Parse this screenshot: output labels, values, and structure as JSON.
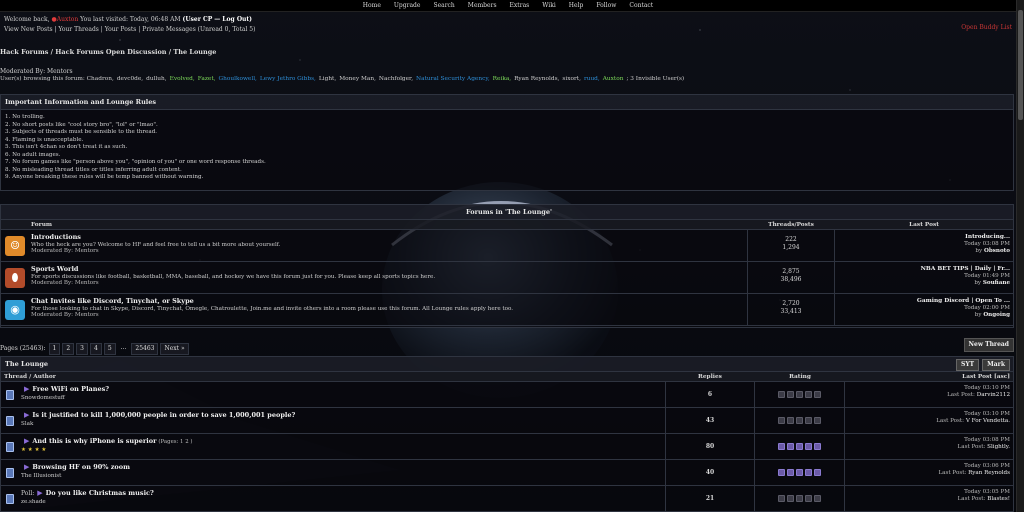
{
  "nav": [
    "Home",
    "Upgrade",
    "Search",
    "Members",
    "Extras",
    "Wiki",
    "Help",
    "Follow",
    "Contact"
  ],
  "userbar": {
    "welcome": "Welcome back,",
    "username": "●Auxton",
    "last_visit": " You last visited: Today, 06:48 AM",
    "user_cp": "(User CP",
    "logout": "— Log Out)",
    "links": "View New Posts | Your Threads | Your Posts | Private Messages (Unread 0, Total 5)",
    "open_log": "Open Buddy List"
  },
  "breadcrumb": "Hack Forums / Hack Forums Open Discussion / The Lounge",
  "moderated_by": "Moderated By: Mentors",
  "browsing": {
    "prefix": "User(s) browsing this forum:",
    "users": [
      "Chadron,",
      "devc0de,",
      "dulluh,",
      "Evolved,",
      "Fazet,",
      "Ghoulkowell,",
      "Lewy Jethro Gibbs,",
      "Light,",
      "Money Man,",
      "Nachfolger,",
      "Natural Security Agency,",
      "Reika,",
      "Ryan Reynolds,",
      "sixort,",
      "ruud,",
      "Auxton",
      "; 3 Invisible User(s)"
    ],
    "colors": [
      "#cfcfcf",
      "#cfcfcf",
      "#cfcfcf",
      "#7ddc5a",
      "#7ddc5a",
      "#2e8fd8",
      "#2e8fd8",
      "#cfcfcf",
      "#cfcfcf",
      "#cfcfcf",
      "#2e8fd8",
      "#7ddc5a",
      "#cfcfcf",
      "#cfcfcf",
      "#2e8fd8",
      "#7ddc5a",
      "#cfcfcf"
    ]
  },
  "rules": {
    "title": "Important Information and Lounge Rules",
    "items": [
      "1. No trolling.",
      "2. No short posts like \"cool story bro\", \"lol\" or \"lmao\".",
      "3. Subjects of threads must be sensible to the thread.",
      "4. Flaming is unacceptable.",
      "5. This isn't 4chan so don't treat it as such.",
      "6. No adult images.",
      "7. No forum games like \"person above you\", \"opinion of you\" or one word response threads.",
      "8. No misleading thread titles or titles inferring adult content.",
      "9. Anyone breaking these rules will be temp banned without warning."
    ]
  },
  "forums": {
    "title": "Forums in 'The Lounge'",
    "headers": {
      "forum": "Forum",
      "tp": "Threads/Posts",
      "last": "Last Post"
    },
    "rows": [
      {
        "name": "Introductions",
        "desc": "Who the heck are you? Welcome to HF and feel free to tell us a bit more about yourself.",
        "mods": "Moderated By: Mentors",
        "threads": "222",
        "posts": "1,294",
        "last_title": "Introducing...",
        "last_time": "Today 03:08 PM",
        "last_by": "by",
        "last_user": "Obsnoto",
        "icon": "intro-icon"
      },
      {
        "name": "Sports World",
        "desc": "For sports discussions like football, basketball, MMA, baseball, and hockey we have this forum just for you. Please keep all sports topics here.",
        "mods": "Moderated By: Mentors",
        "threads": "2,875",
        "posts": "38,496",
        "last_title": "NBA BET TIPS | Daily | Fr...",
        "last_time": "Today 01:49 PM",
        "last_by": "by",
        "last_user": "Soufiane",
        "icon": "football-icon"
      },
      {
        "name": "Chat Invites like Discord, Tinychat, or Skype",
        "desc": "For those looking to chat in Skype, Discord, Tinychat, Omegle, Chatroulette, Join.me and invite others into a room please use this forum. All Lounge rules apply here too.",
        "mods": "Moderated By: Mentors",
        "threads": "2,720",
        "posts": "33,413",
        "last_title": "Gaming Discord | Open To ...",
        "last_time": "Today 02:00 PM",
        "last_by": "by",
        "last_user": "Ongoing",
        "icon": "chat-icon"
      }
    ]
  },
  "pagination": {
    "label": "Pages (25463):",
    "pages": [
      "1",
      "2",
      "3",
      "4",
      "5",
      "...",
      "25463",
      "Next »"
    ]
  },
  "new_thread": "New Thread",
  "threads": {
    "title": "The Lounge",
    "btn_syt": "SYT",
    "btn_mark": "Mark",
    "headers": {
      "author": "Thread / Author",
      "replies": "Replies",
      "rating": "Rating",
      "last": "Last Post [asc]"
    },
    "rows": [
      {
        "prefix": "",
        "name": "Free WiFi on Planes?",
        "pages": "",
        "author": "Snowdomestuff",
        "replies": "6",
        "rating": 0,
        "time": "Today 03:10 PM",
        "last_label": "Last Post:",
        "last_user": "Darvin2112"
      },
      {
        "prefix": "",
        "name": "Is it justified to kill 1,000,000 people in order to save 1,000,001 people?",
        "pages": "",
        "author": "Slak",
        "replies": "43",
        "rating": 0,
        "time": "Today 03:10 PM",
        "last_label": "Last Post:",
        "last_user": "V For Vendetta."
      },
      {
        "prefix": "",
        "name": "And this is why iPhone is superior",
        "pages": "(Pages: 1 2 )",
        "author": "★ ★ ★ ★",
        "replies": "80",
        "rating": 5,
        "time": "Today 03:08 PM",
        "last_label": "Last Post:",
        "last_user": "Slightly."
      },
      {
        "prefix": "",
        "name": "Browsing HF on 90% zoom",
        "pages": "",
        "author": "The Illusionist",
        "replies": "40",
        "rating": 5,
        "time": "Today 03:06 PM",
        "last_label": "Last Post:",
        "last_user": "Ryan Reynolds"
      },
      {
        "prefix": "Poll:",
        "name": "Do you like Christmas music?",
        "pages": "",
        "author": "ze.shade",
        "replies": "21",
        "rating": 0,
        "time": "Today 03:05 PM",
        "last_label": "Last Post:",
        "last_user": "Blastes!"
      }
    ]
  },
  "colors": {
    "accent": "#8a6bd6",
    "red": "#e23b3b",
    "green": "#7ddc5a",
    "blue": "#2e8fd8"
  }
}
